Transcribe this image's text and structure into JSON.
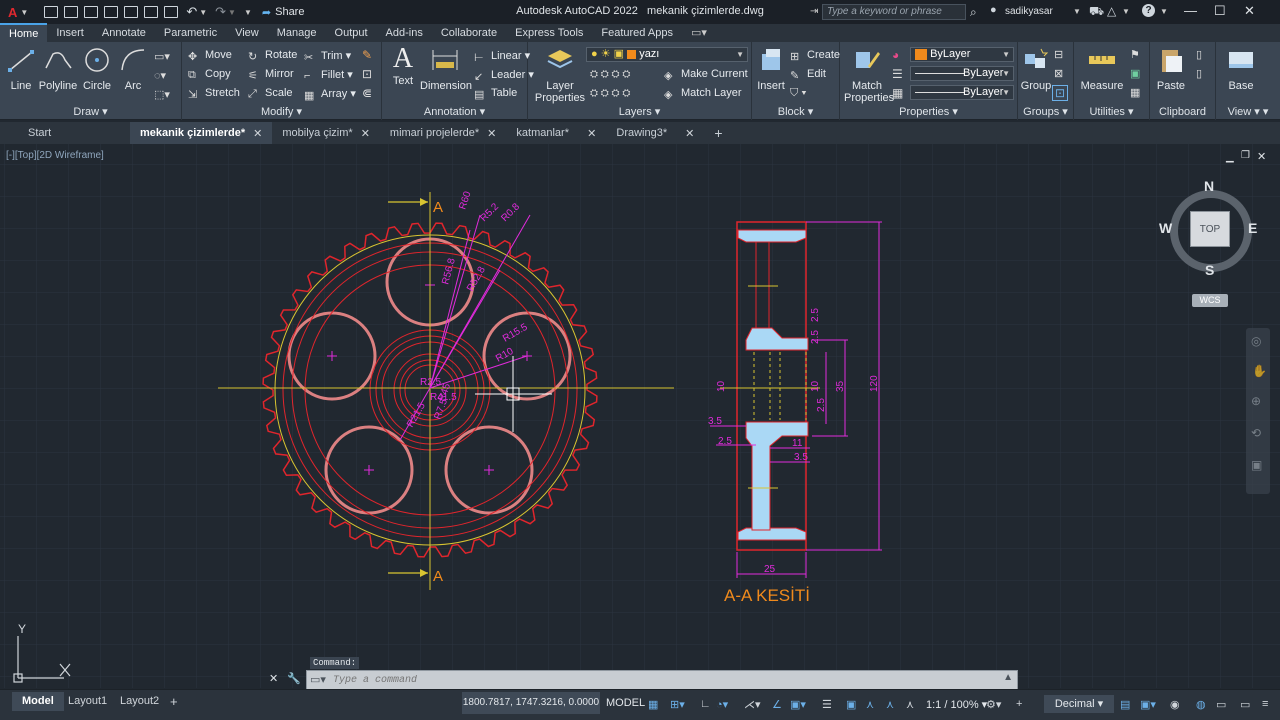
{
  "titlebar": {
    "app_title": "Autodesk AutoCAD 2022",
    "file_title": "mekanik çizimlerde.dwg",
    "share_label": "Share",
    "search_placeholder": "Type a keyword or phrase",
    "username": "sadikyasar"
  },
  "menu_tabs": [
    "Home",
    "Insert",
    "Annotate",
    "Parametric",
    "View",
    "Manage",
    "Output",
    "Add-ins",
    "Collaborate",
    "Express Tools",
    "Featured Apps"
  ],
  "ribbon": {
    "draw": {
      "title": "Draw",
      "line": "Line",
      "polyline": "Polyline",
      "circle": "Circle",
      "arc": "Arc"
    },
    "modify": {
      "title": "Modify",
      "move": "Move",
      "rotate": "Rotate",
      "trim": "Trim",
      "copy": "Copy",
      "mirror": "Mirror",
      "fillet": "Fillet",
      "stretch": "Stretch",
      "scale": "Scale",
      "array": "Array"
    },
    "annotation": {
      "title": "Annotation",
      "text": "Text",
      "dimension": "Dimension",
      "linear": "Linear",
      "leader": "Leader",
      "table": "Table"
    },
    "layers": {
      "title": "Layers",
      "layer_properties": "Layer Properties",
      "current_layer": "yazı",
      "make_current": "Make Current",
      "match_layer": "Match Layer"
    },
    "block": {
      "title": "Block",
      "insert": "Insert",
      "create": "Create",
      "edit": "Edit"
    },
    "properties": {
      "title": "Properties",
      "match_properties": "Match Properties",
      "color": "ByLayer",
      "linetype": "ByLayer",
      "lineweight": "ByLayer"
    },
    "groups": {
      "title": "Groups",
      "group": "Group"
    },
    "utilities": {
      "title": "Utilities",
      "measure": "Measure"
    },
    "clipboard": {
      "title": "Clipboard",
      "paste": "Paste"
    },
    "view": {
      "title": "View",
      "base": "Base"
    }
  },
  "file_tabs": [
    {
      "label": "Start",
      "closable": false,
      "active": false
    },
    {
      "label": "mekanik çizimlerde*",
      "closable": true,
      "active": true
    },
    {
      "label": "mobilya çizim*",
      "closable": true,
      "active": false
    },
    {
      "label": "mimari projelerde*",
      "closable": true,
      "active": false
    },
    {
      "label": "katmanlar*",
      "closable": true,
      "active": false
    },
    {
      "label": "Drawing3*",
      "closable": true,
      "active": false
    }
  ],
  "viewport_label": "[-][Top][2D Wireframe]",
  "viewcube": {
    "n": "N",
    "s": "S",
    "e": "E",
    "w": "W",
    "face": "TOP",
    "wcs": "WCS"
  },
  "drawing": {
    "section_marker": "A",
    "section_title": "A-A KESİTİ",
    "front_dims": [
      "R60",
      "R5.2",
      "R0.8",
      "R56.8",
      "R52.8",
      "R15.5",
      "R10",
      "R2.5",
      "R7.5",
      "R21.5",
      "R41.5",
      "R45"
    ],
    "side_dims": {
      "width": "25",
      "height": "120",
      "d35": "35",
      "d2_5a": "2.5",
      "d3_5a": "3.5",
      "d2_5b": "2.5",
      "d11": "11",
      "d3_5b": "3.5",
      "d2_5c": "2.5",
      "d2_5d": "2.5",
      "d10a": "10",
      "d10b": "10"
    }
  },
  "command": {
    "history_label": "Command:",
    "placeholder": "Type a command"
  },
  "ucs": {
    "x": "X",
    "y": "Y"
  },
  "statusbar": {
    "model_tab": "Model",
    "layout1": "Layout1",
    "layout2": "Layout2",
    "coordinates": "1800.7817, 1747.3216, 0.0000",
    "model_space": "MODEL",
    "scale": "1:1 / 100%",
    "units": "Decimal"
  },
  "colors": {
    "red": "#e0252c",
    "yellow": "#d8c431",
    "magenta": "#e12bdc",
    "cyan_fill": "#aad8f5",
    "orange": "#f08a1c",
    "pink": "#ef8c8c"
  }
}
